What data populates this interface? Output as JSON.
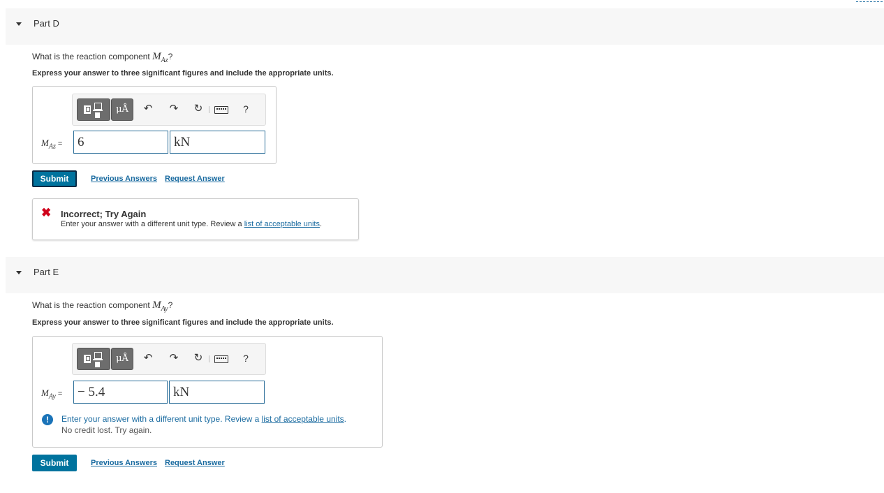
{
  "part_d": {
    "title": "Part D",
    "question_prefix": "What is the reaction component ",
    "var_main": "M",
    "var_sub": "Az",
    "question_suffix": "?",
    "instruction": "Express your answer to three significant figures and include the appropriate units.",
    "toolbar": {
      "units_label": "μÅ",
      "help_label": "?"
    },
    "eq": "=",
    "value": "6",
    "unit": "kN",
    "submit_label": "Submit",
    "previous_answers_label": "Previous Answers",
    "request_answer_label": "Request Answer",
    "feedback": {
      "title": "Incorrect; Try Again",
      "message_prefix": "Enter your answer with a different unit type. Review a ",
      "link_text": "list of acceptable units",
      "message_suffix": "."
    }
  },
  "part_e": {
    "title": "Part E",
    "question_prefix": "What is the reaction component ",
    "var_main": "M",
    "var_sub": "Ay",
    "question_suffix": "?",
    "instruction": "Express your answer to three significant figures and include the appropriate units.",
    "toolbar": {
      "units_label": "μÅ",
      "help_label": "?"
    },
    "eq": "=",
    "value": "− 5.4",
    "unit": "kN",
    "hint": {
      "message_prefix": "Enter your answer with a different unit type. Review a ",
      "link_text": "list of acceptable units",
      "message_suffix": ".",
      "line2": "No credit lost. Try again."
    },
    "submit_label": "Submit",
    "previous_answers_label": "Previous Answers",
    "request_answer_label": "Request Answer"
  },
  "icons": {
    "undo": "↶",
    "redo": "↷",
    "reset": "↻",
    "incorrect": "✖",
    "hint": "!"
  },
  "colors": {
    "submit": "#00739e",
    "link": "#1a6ba0",
    "error": "#d0021b"
  }
}
